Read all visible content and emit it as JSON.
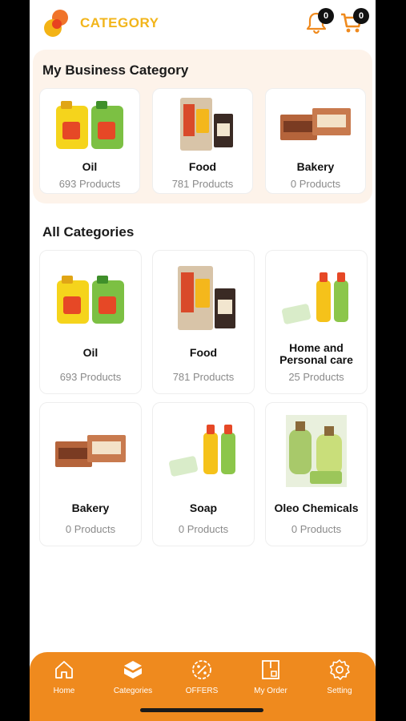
{
  "header": {
    "title": "CATEGORY",
    "notification_count": "0",
    "cart_count": "0"
  },
  "business": {
    "title": "My Business Category",
    "items": [
      {
        "name": "Oil",
        "count": "693 Products"
      },
      {
        "name": "Food",
        "count": "781 Products"
      },
      {
        "name": "Bakery",
        "count": "0 Products"
      }
    ]
  },
  "all": {
    "title": "All Categories",
    "items": [
      {
        "name": "Oil",
        "count": "693 Products"
      },
      {
        "name": "Food",
        "count": "781 Products"
      },
      {
        "name": "Home and\nPersonal care",
        "name1": "Home and",
        "name2": "Personal care",
        "count": "25 Products"
      },
      {
        "name": "Bakery",
        "count": "0 Products"
      },
      {
        "name": "Soap",
        "count": "0 Products"
      },
      {
        "name": "Oleo Chemicals",
        "count": "0 Products"
      }
    ]
  },
  "nav": {
    "items": [
      {
        "label": "Home"
      },
      {
        "label": "Categories"
      },
      {
        "label": "OFFERS"
      },
      {
        "label": "My Order"
      },
      {
        "label": "Setting"
      }
    ]
  },
  "colors": {
    "accent": "#ef8a1e",
    "title_yellow": "#f2b51b",
    "section_bg": "#fdf3ea"
  },
  "icons": [
    "bell-icon",
    "cart-icon",
    "home-icon",
    "categories-icon",
    "offers-icon",
    "order-icon",
    "setting-icon"
  ]
}
